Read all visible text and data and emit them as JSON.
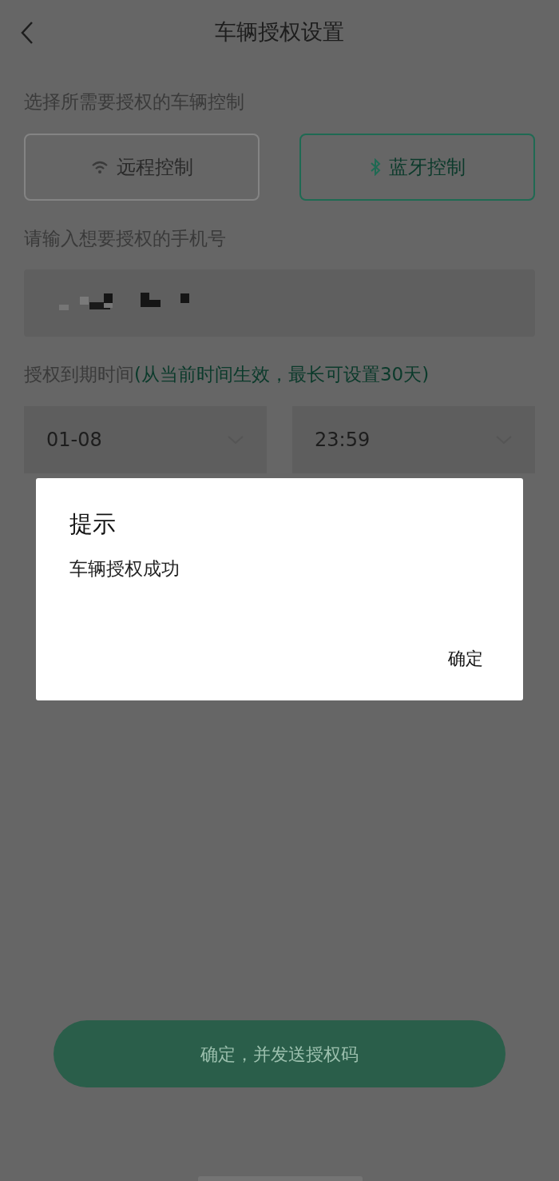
{
  "header": {
    "title": "车辆授权设置"
  },
  "control_section": {
    "label": "选择所需要授权的车辆控制",
    "options": [
      {
        "label": "远程控制",
        "kind": "wifi",
        "selected": false
      },
      {
        "label": "蓝牙控制",
        "kind": "bluetooth",
        "selected": true
      }
    ]
  },
  "phone_section": {
    "label": "请输入想要授权的手机号"
  },
  "expiry_section": {
    "label": "授权到期时间",
    "hint": "(从当前时间生效，最长可设置30天)",
    "date": {
      "value": "01-08"
    },
    "time": {
      "value": "23:59"
    }
  },
  "submit_button": {
    "label": "确定，并发送授权码"
  },
  "dialog": {
    "title": "提示",
    "message": "车辆授权成功",
    "confirm": "确定"
  }
}
